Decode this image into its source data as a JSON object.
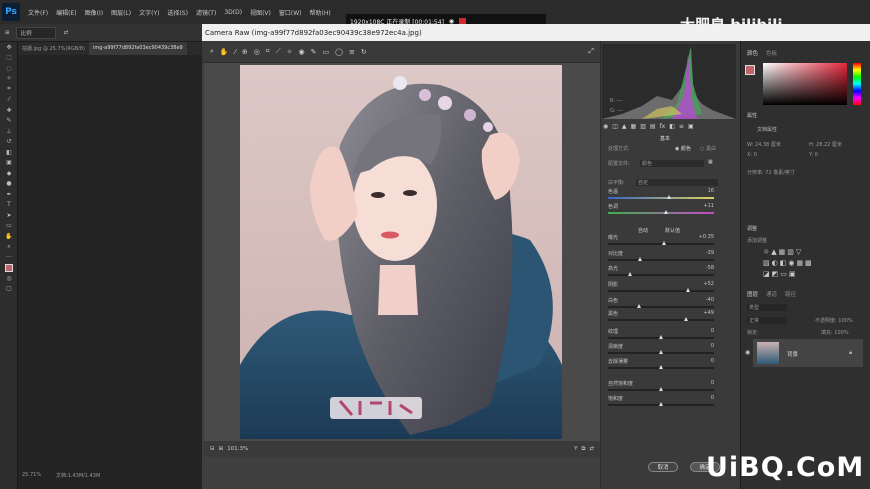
{
  "app": {
    "logo": "Ps",
    "menus": [
      "文件(F)",
      "编辑(E)",
      "图像(I)",
      "图层(L)",
      "文字(Y)",
      "选择(S)",
      "滤镜(T)",
      "3D(D)",
      "视图(V)",
      "窗口(W)",
      "帮助(H)"
    ]
  },
  "options_bar": {
    "mode": "比例"
  },
  "doc_tabs": [
    "拍摄.jpg @ 25.7%(RGB/8)",
    "img-a99f77d892fa03ec90439c38e9"
  ],
  "status_left": "25.71%",
  "status_mid": "文档:1.43M/1.43M",
  "recorder": {
    "text": "1920x108C  正在录制 [00:01:54]"
  },
  "camera_raw": {
    "title": "Camera Raw (img-a99f77d892fa03ec90439c38e972ec4a.jpg)",
    "zoom": "101.3%",
    "panel_title": "基本",
    "treatment_label": "处理方式:",
    "treatment_color": "颜色",
    "treatment_bw": "黑白",
    "profile_label": "配置文件:",
    "profile_value": "颜色",
    "wb_label": "白平衡:",
    "wb_value": "自定",
    "auto_label": "自动",
    "default_label": "默认值",
    "sliders": [
      {
        "label": "色温",
        "value": "16",
        "pos": 0.58
      },
      {
        "label": "色调",
        "value": "+11",
        "pos": 0.55
      },
      {
        "label": "曝光",
        "value": "+0.35",
        "pos": 0.53
      },
      {
        "label": "对比度",
        "value": "-39",
        "pos": 0.31
      },
      {
        "label": "高光",
        "value": "-58",
        "pos": 0.21
      },
      {
        "label": "阴影",
        "value": "+52",
        "pos": 0.76
      },
      {
        "label": "白色",
        "value": "-40",
        "pos": 0.3
      },
      {
        "label": "黑色",
        "value": "+49",
        "pos": 0.74
      },
      {
        "label": "纹理",
        "value": "0",
        "pos": 0.5
      },
      {
        "label": "清晰度",
        "value": "0",
        "pos": 0.5
      },
      {
        "label": "去除薄雾",
        "value": "0",
        "pos": 0.5
      },
      {
        "label": "自然饱和度",
        "value": "0",
        "pos": 0.5
      },
      {
        "label": "饱和度",
        "value": "0",
        "pos": 0.5
      }
    ],
    "cancel_label": "取消",
    "ok_label": "确定"
  },
  "right_panels": {
    "color_tabs": [
      "颜色",
      "色板"
    ],
    "props_title": "属性",
    "doc_props": "文档属性",
    "width_label": "W: 24.38 厘米",
    "height_label": "H: 28.22 厘米",
    "x_label": "X: 0",
    "y_label": "Y: 0",
    "resolution": "分辨率: 72 像素/英寸",
    "adjust_title": "调整",
    "adjust_add": "添加调整",
    "layers_tabs": [
      "图层",
      "通道",
      "路径"
    ],
    "layer_kind": "类型",
    "blend_mode": "正常",
    "opacity": "不透明度: 100%",
    "lock_label": "锁定:",
    "fill": "填充: 100%",
    "layer_name": "背景"
  },
  "watermarks": {
    "top": "大肥皂 bilibili",
    "bottom": "UiBQ.CoM"
  },
  "colors": {
    "accent": "#1473e6",
    "foreground": "#c0646c",
    "ps_blue": "#31a8ff"
  }
}
